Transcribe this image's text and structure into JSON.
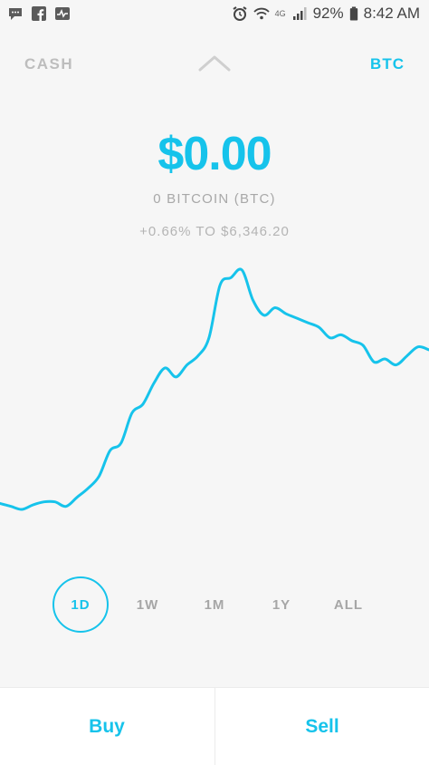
{
  "status": {
    "battery_percent": "92%",
    "time": "8:42 AM",
    "network": "4G",
    "icons_left": [
      "chat-icon",
      "facebook-icon",
      "activity-icon"
    ],
    "icons_right": [
      "alarm-icon",
      "wifi-icon",
      "signal-icon",
      "battery-icon"
    ]
  },
  "nav": {
    "left": "CASH",
    "right": "BTC"
  },
  "balance": {
    "amount": "$0.00",
    "holding": "0 BITCOIN (BTC)",
    "change": "+0.66% TO $6,346.20"
  },
  "ranges": [
    "1D",
    "1W",
    "1M",
    "1Y",
    "ALL"
  ],
  "active_range": "1D",
  "actions": {
    "buy": "Buy",
    "sell": "Sell"
  },
  "colors": {
    "accent": "#16c3eb",
    "background": "#f6f6f6",
    "muted": "#a6a6a6"
  },
  "chart_data": {
    "type": "line",
    "title": "",
    "xlabel": "",
    "ylabel": "",
    "grid": false,
    "series": [
      {
        "values": [
          6120,
          6118,
          6116,
          6119,
          6121,
          6121,
          6118,
          6124,
          6130,
          6138,
          6155,
          6160,
          6180,
          6186,
          6200,
          6210,
          6204,
          6212,
          6218,
          6230,
          6265,
          6270,
          6275,
          6255,
          6245,
          6250,
          6246,
          6243,
          6240,
          6237,
          6230,
          6232,
          6228,
          6225,
          6214,
          6216,
          6212,
          6218,
          6224,
          6222
        ]
      }
    ]
  }
}
